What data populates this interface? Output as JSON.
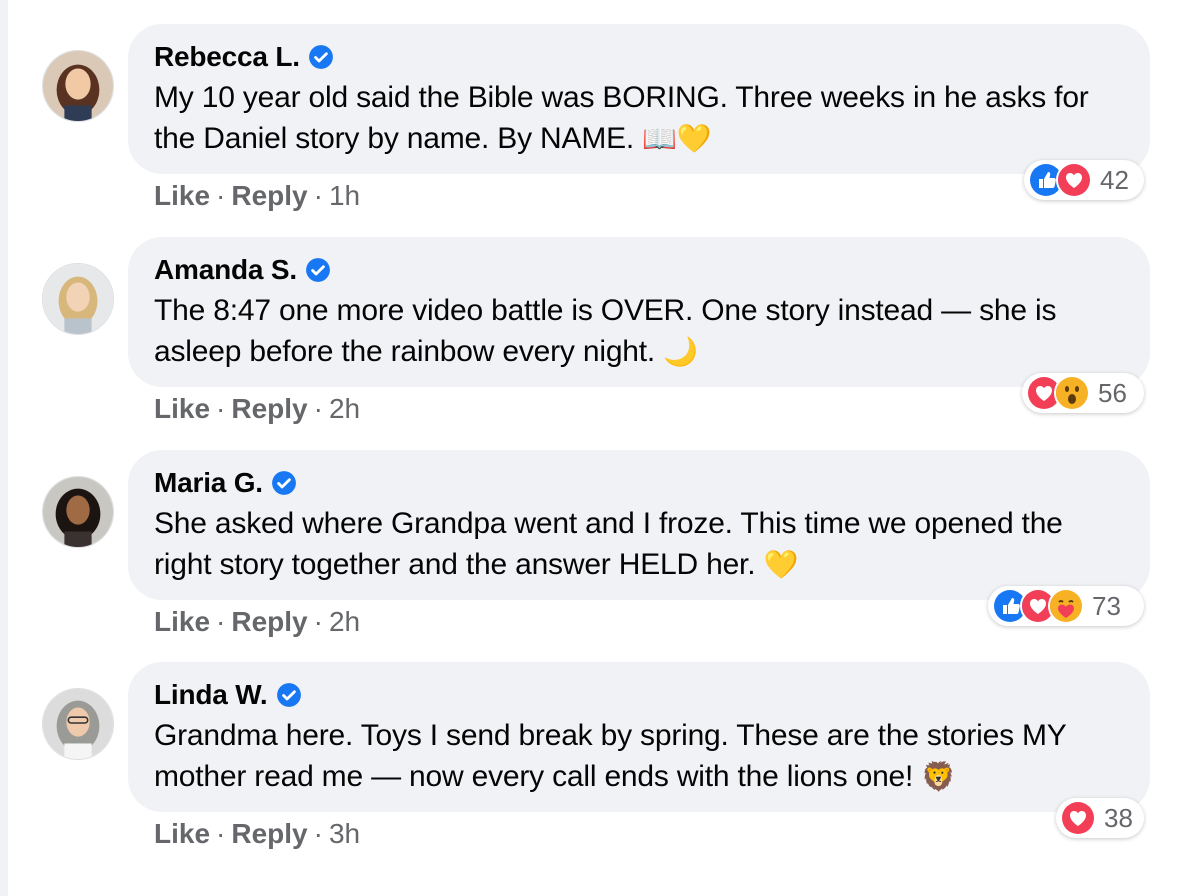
{
  "comments": [
    {
      "author": "Rebecca L.",
      "text": "My 10 year old said the Bible was BORING. Three weeks in he asks for the Daniel story by name. By NAME.",
      "emoji": "📖💛",
      "like_label": "Like",
      "reply_label": "Reply",
      "time": "1h",
      "reaction_count": "42",
      "reactions": [
        "like",
        "love"
      ]
    },
    {
      "author": "Amanda S.",
      "text": "The 8:47 one more video battle is OVER. One story instead — she is asleep before the rainbow every night.",
      "emoji": "🌙",
      "like_label": "Like",
      "reply_label": "Reply",
      "time": "2h",
      "reaction_count": "56",
      "reactions": [
        "love",
        "wow"
      ]
    },
    {
      "author": "Maria G.",
      "text": "She asked where Grandpa went and I froze. This time we opened the right story together and the answer HELD her.",
      "emoji": "💛",
      "like_label": "Like",
      "reply_label": "Reply",
      "time": "2h",
      "reaction_count": "73",
      "reactions": [
        "like",
        "love",
        "care"
      ]
    },
    {
      "author": "Linda W.",
      "text": "Grandma here. Toys I send break by spring. These are the stories MY mother read me — now every call ends with the lions one!",
      "emoji": "🦁",
      "like_label": "Like",
      "reply_label": "Reply",
      "time": "3h",
      "reaction_count": "38",
      "reactions": [
        "love"
      ]
    }
  ],
  "colors": {
    "bubble": "#f0f2f5",
    "meta_text": "#65676b",
    "verified": "#1877f2",
    "like": "#1877f2",
    "love": "#f33e58",
    "wow": "#f7b125"
  }
}
